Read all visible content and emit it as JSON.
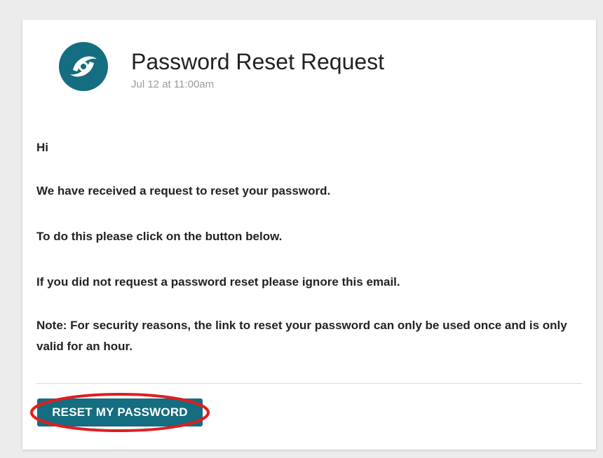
{
  "email": {
    "subject": "Password Reset Request",
    "timestamp": "Jul 12 at 11:00am",
    "logo_icon": "brand-swirl-logo-icon",
    "brand_color": "#146d80",
    "body": {
      "greeting": "Hi",
      "line1": "We have received a request to reset your password.",
      "line2": "To do this please click on the button below.",
      "line3": "If you did not request a password reset please ignore this email.",
      "note": "Note: For security reasons, the link to reset your password can only be used once and is only valid for an hour."
    },
    "cta_label": "RESET MY PASSWORD"
  },
  "annotation": {
    "highlight_color": "#e01e1e"
  }
}
